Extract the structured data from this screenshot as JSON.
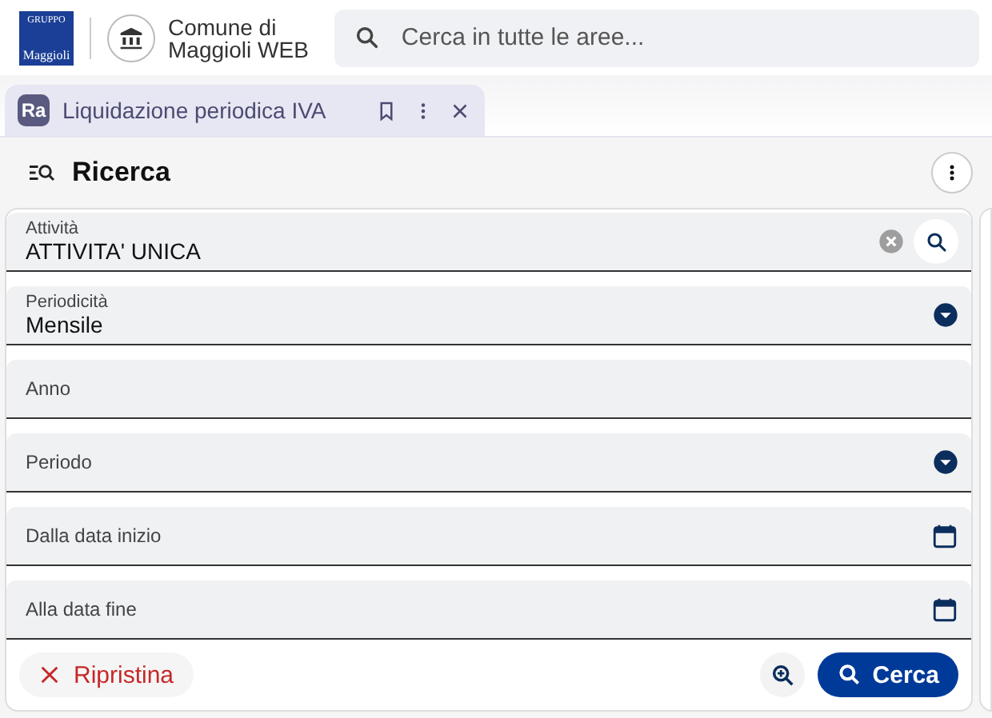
{
  "header": {
    "logo": {
      "top": "GRUPPO",
      "bottom": "Maggioli"
    },
    "org_name": "Comune di\nMaggioli WEB",
    "search": {
      "placeholder": "Cerca in tutte le aree..."
    }
  },
  "tabs": [
    {
      "icon_text": "Ra",
      "label": "Liquidazione periodica IVA",
      "selected": true
    }
  ],
  "section": {
    "title": "Ricerca"
  },
  "fields": [
    {
      "kind": "autocomplete",
      "label": "Attività",
      "value": "ATTIVITA' UNICA"
    },
    {
      "kind": "select",
      "label": "Periodicità",
      "value": "Mensile"
    },
    {
      "kind": "text",
      "label": "Anno"
    },
    {
      "kind": "select",
      "label": "Periodo"
    },
    {
      "kind": "date",
      "label": "Dalla data inizio"
    },
    {
      "kind": "date",
      "label": "Alla data fine"
    }
  ],
  "actions": {
    "reset": "Ripristina",
    "search": "Cerca"
  }
}
